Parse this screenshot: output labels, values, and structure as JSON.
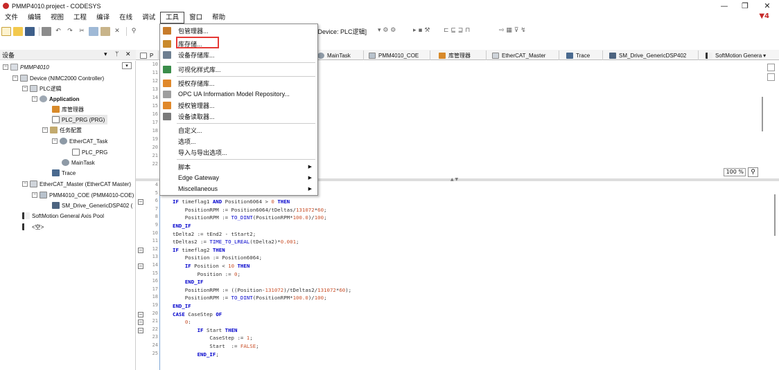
{
  "window": {
    "title": "PMMP4010.project - CODESYS",
    "controls": [
      "—",
      "❐",
      "✕"
    ],
    "alert_count": "4"
  },
  "menu": {
    "items": [
      "文件",
      "编辑",
      "视图",
      "工程",
      "编译",
      "在线",
      "调试",
      "工具",
      "窗口",
      "帮助"
    ],
    "active": "工具"
  },
  "toolbar": {
    "device": "[Device: PLC逻辑]"
  },
  "devices_panel": {
    "title": "设备",
    "controls": [
      "▾",
      "ᛘ",
      "✕"
    ],
    "tree": [
      {
        "label": "PMMP4010",
        "italic": true
      },
      {
        "label": "Device (NIMC2000 Controller)"
      },
      {
        "label": "PLC逻辑"
      },
      {
        "label": "Application",
        "bold": true
      },
      {
        "label": "库管理器"
      },
      {
        "label": "PLC_PRG (PRG)",
        "selected": true
      },
      {
        "label": "任务配置"
      },
      {
        "label": "EtherCAT_Task"
      },
      {
        "label": "PLC_PRG"
      },
      {
        "label": "MainTask"
      },
      {
        "label": "Trace"
      },
      {
        "label": "EtherCAT_Master (EtherCAT Master)"
      },
      {
        "label": "PMM4010_COE (PMM4010-COE)"
      },
      {
        "label": "SM_Drive_GenericDSP402 ("
      },
      {
        "label": "SoftMotion General Axis Pool"
      },
      {
        "label": "<空>"
      }
    ]
  },
  "tabs": [
    {
      "label": "P"
    },
    {
      "label": "MainTask"
    },
    {
      "label": "PMM4010_COE"
    },
    {
      "label": "库管理器"
    },
    {
      "label": "EtherCAT_Master"
    },
    {
      "label": "Trace"
    },
    {
      "label": "SM_Drive_GenericDSP402"
    },
    {
      "label": "SoftMotion Genera"
    }
  ],
  "tabs_overflow": "▾",
  "top_editor": {
    "line_numbers": [
      "10",
      "11",
      "12",
      "13",
      "14",
      "15",
      "16",
      "17",
      "18",
      "19",
      "20",
      "21",
      "22"
    ],
    "zoom": "100 %"
  },
  "tools_menu": {
    "items": [
      {
        "label": "包管理器...",
        "color": "#c77b2a"
      },
      {
        "label": "库存储...",
        "color": "#c9892b",
        "highlighted": true
      },
      {
        "label": "设备存储库...",
        "color": "#6e7f91"
      },
      {
        "label": "可视化样式库...",
        "color": "#3a8d4a"
      },
      {
        "label": "授权存储库...",
        "color": "#e0882a"
      },
      {
        "label": "OPC UA Information Model Repository...",
        "color": "#9e9e9e"
      },
      {
        "label": "授权管理器...",
        "color": "#e0882a"
      },
      {
        "label": "设备读取器...",
        "color": "#7a7a7a"
      },
      {
        "label": "自定义...",
        "color": ""
      },
      {
        "label": "选项...",
        "color": ""
      },
      {
        "label": "导入与导出选项...",
        "color": ""
      },
      {
        "label": "脚本",
        "color": "",
        "submenu": true
      },
      {
        "label": "Edge Gateway",
        "color": "",
        "submenu": true
      },
      {
        "label": "Miscellaneous",
        "color": "",
        "submenu": true
      }
    ]
  },
  "code_editor": {
    "lines": [
      {
        "n": "4",
        "text": ""
      },
      {
        "n": "5",
        "text": ""
      },
      {
        "n": "6",
        "text": "IF timeflag1 AND Position6064 > 0 THEN",
        "fold": true
      },
      {
        "n": "7",
        "text": "    PositionRPM := Position6064/tDeltas/131072*60;"
      },
      {
        "n": "8",
        "text": "    PositionRPM := TO_DINT(PositionRPM*100.0)/100;"
      },
      {
        "n": "9",
        "text": "END_IF"
      },
      {
        "n": "10",
        "text": "tDelta2 := tEnd2 - tStart2;"
      },
      {
        "n": "11",
        "text": "tDeltas2 := TIME_TO_LREAL(tDelta2)*0.001;"
      },
      {
        "n": "12",
        "text": "IF timeflag2 THEN",
        "fold": true
      },
      {
        "n": "13",
        "text": "    Position := Position6064;"
      },
      {
        "n": "14",
        "text": "    IF Position < 10 THEN",
        "fold": true
      },
      {
        "n": "15",
        "text": "        Position := 0;"
      },
      {
        "n": "16",
        "text": "    END_IF"
      },
      {
        "n": "17",
        "text": "    PositionRPM := ((Position-131072)/tDeltas2/131072*60);"
      },
      {
        "n": "18",
        "text": "    PositionRPM := TO_DINT(PositionRPM*100.0)/100;"
      },
      {
        "n": "19",
        "text": "END_IF"
      },
      {
        "n": "20",
        "text": "CASE CaseStep OF",
        "fold": true
      },
      {
        "n": "21",
        "text": "    0:",
        "fold": true
      },
      {
        "n": "22",
        "text": "        IF Start THEN",
        "fold": true
      },
      {
        "n": "23",
        "text": "            CaseStep := 1;"
      },
      {
        "n": "24",
        "text": "            Start  := FALSE;"
      },
      {
        "n": "25",
        "text": "        END_IF;"
      }
    ]
  }
}
